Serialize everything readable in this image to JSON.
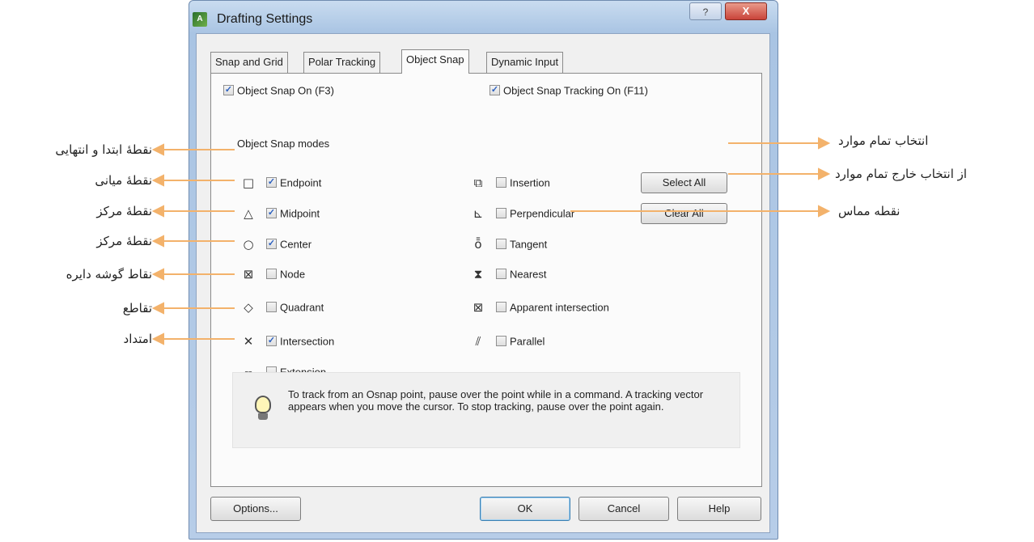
{
  "window": {
    "title": "Drafting Settings",
    "app_icon": "autocad-icon",
    "help_glyph": "?",
    "close_glyph": "X"
  },
  "tabs": [
    {
      "label": "Snap and Grid",
      "active": false
    },
    {
      "label": "Polar Tracking",
      "active": false
    },
    {
      "label": "Object Snap",
      "active": true
    },
    {
      "label": "Dynamic Input",
      "active": false
    }
  ],
  "object_snap": {
    "snap_on_label": "Object Snap On (F3)",
    "snap_on_checked": true,
    "tracking_on_label": "Object Snap Tracking On (F11)",
    "tracking_on_checked": true,
    "modes_caption": "Object Snap modes",
    "left_modes": [
      {
        "label": "Endpoint",
        "checked": true,
        "icon": "□"
      },
      {
        "label": "Midpoint",
        "checked": true,
        "icon": "△"
      },
      {
        "label": "Center",
        "checked": true,
        "icon": "○"
      },
      {
        "label": "Node",
        "checked": false,
        "icon": "⊠"
      },
      {
        "label": "Quadrant",
        "checked": false,
        "icon": "◇"
      },
      {
        "label": "Intersection",
        "checked": true,
        "icon": "✕"
      },
      {
        "label": "Extension",
        "checked": false,
        "icon": "╌"
      }
    ],
    "right_modes": [
      {
        "label": "Insertion",
        "checked": false,
        "icon": "⧉"
      },
      {
        "label": "Perpendicular",
        "checked": false,
        "icon": "⊾"
      },
      {
        "label": "Tangent",
        "checked": false,
        "icon": "ȭ"
      },
      {
        "label": "Nearest",
        "checked": false,
        "icon": "⧗"
      },
      {
        "label": "Apparent intersection",
        "checked": false,
        "icon": "⊠"
      },
      {
        "label": "Parallel",
        "checked": false,
        "icon": "⫽"
      }
    ],
    "select_all_label": "Select All",
    "clear_all_label": "Clear All",
    "info_text": "To track from an Osnap point, pause over the point while in a command.  A tracking vector appears when you move the cursor. To stop tracking, pause over the point again."
  },
  "footer": {
    "options_label": "Options...",
    "ok_label": "OK",
    "cancel_label": "Cancel",
    "help_label": "Help"
  },
  "annotations": {
    "left": [
      "نقطهٔ ابتدا و انتهایی",
      "نقطهٔ میانی",
      "نقطهٔ مرکز",
      "نقطهٔ مرکز",
      "نقاط گوشه دایره",
      "تقاطع",
      "امتداد"
    ],
    "right": [
      "انتخاب تمام موارد",
      "از انتخاب خارج تمام موارد",
      "نقطه مماس"
    ],
    "arrow_color": "#f3b26b"
  }
}
